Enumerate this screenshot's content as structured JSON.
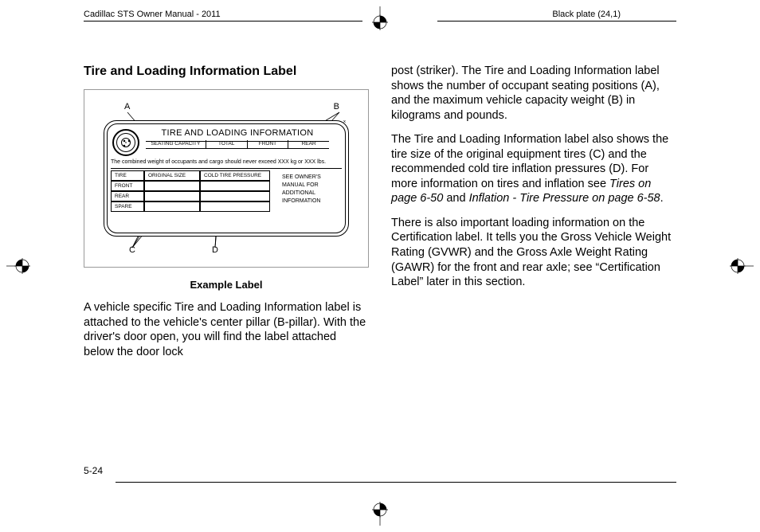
{
  "header": {
    "left": "Cadillac STS Owner Manual - 2011",
    "right": "Black plate (24,1)"
  },
  "section_title": "Tire and Loading Information Label",
  "label": {
    "title": "TIRE AND LOADING INFORMATION",
    "seating_capacity": "SEATING CAPACITY",
    "total": "TOTAL",
    "front": "FRONT",
    "rear": "REAR",
    "combined_weight": "The combined weight of occupants and cargo should never exceed  XXX kg or XXX lbs.",
    "tire": "TIRE",
    "original_size": "ORIGINAL SIZE",
    "cold_pressure": "COLD TIRE PRESSURE",
    "spare": "SPARE",
    "owners_manual": "SEE OWNER'S MANUAL FOR ADDITIONAL INFORMATION",
    "callouts": {
      "A": "A",
      "B": "B",
      "C": "C",
      "D": "D"
    }
  },
  "caption": "Example Label",
  "left_column": {
    "p1": "A vehicle specific Tire and Loading Information label is attached to the vehicle's center pillar (B-pillar). With the driver's door open, you will find the label attached below the door lock"
  },
  "right_column": {
    "p1": "post (striker). The Tire and Loading Information label shows the number of occupant seating positions (A), and the maximum vehicle capacity weight (B) in kilograms and pounds.",
    "p2a": "The Tire and Loading Information label also shows the tire size of the original equipment tires (C) and the recommended cold tire inflation pressures (D). For more information on tires and inflation see ",
    "p2b": "Tires on page 6‑50",
    "p2c": " and ",
    "p2d": "Inflation - Tire Pressure on page 6‑58",
    "p2e": ".",
    "p3": "There is also important loading information on the Certification label. It tells you the Gross Vehicle Weight Rating (GVWR) and the Gross Axle Weight Rating (GAWR) for the front and rear axle; see “Certification Label” later in this section."
  },
  "page_number": "5-24"
}
